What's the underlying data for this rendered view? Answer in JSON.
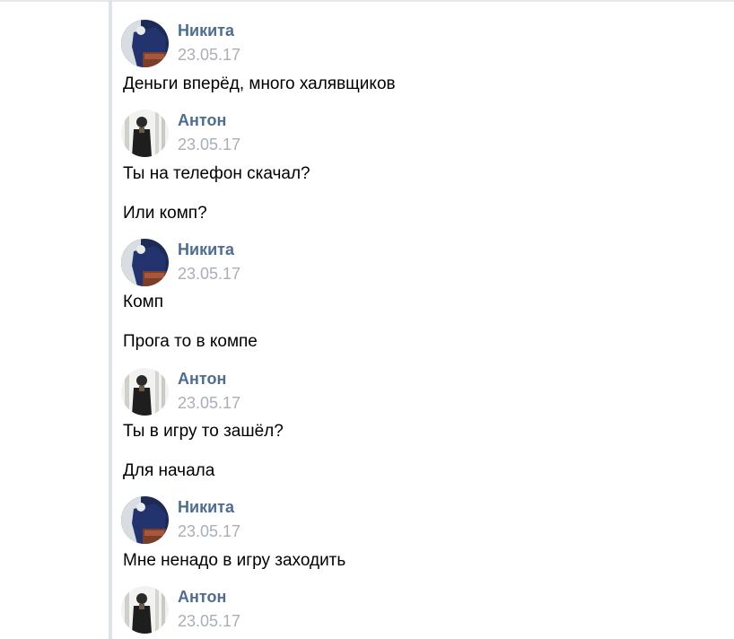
{
  "conversation": [
    {
      "author": "Никита",
      "date": "23.05.17",
      "avatar": "nikita-avatar",
      "messages": [
        "Деньги вперёд, много халявщиков"
      ]
    },
    {
      "author": "Антон",
      "date": "23.05.17",
      "avatar": "anton-avatar",
      "messages": [
        "Ты на телефон скачал?",
        "Или комп?"
      ]
    },
    {
      "author": "Никита",
      "date": "23.05.17",
      "avatar": "nikita-avatar",
      "messages": [
        "Комп",
        "Прога то в компе"
      ]
    },
    {
      "author": "Антон",
      "date": "23.05.17",
      "avatar": "anton-avatar",
      "messages": [
        "Ты в игру то зашёл?",
        "Для начала"
      ]
    },
    {
      "author": "Никита",
      "date": "23.05.17",
      "avatar": "nikita-avatar",
      "messages": [
        "Мне ненадо в игру заходить"
      ]
    },
    {
      "author": "Антон",
      "date": "23.05.17",
      "avatar": "anton-avatar",
      "messages": []
    }
  ],
  "colors": {
    "author": "#4f6d8e",
    "date": "#a9afb6",
    "text": "#000000",
    "rail": "#dfe3e9"
  }
}
